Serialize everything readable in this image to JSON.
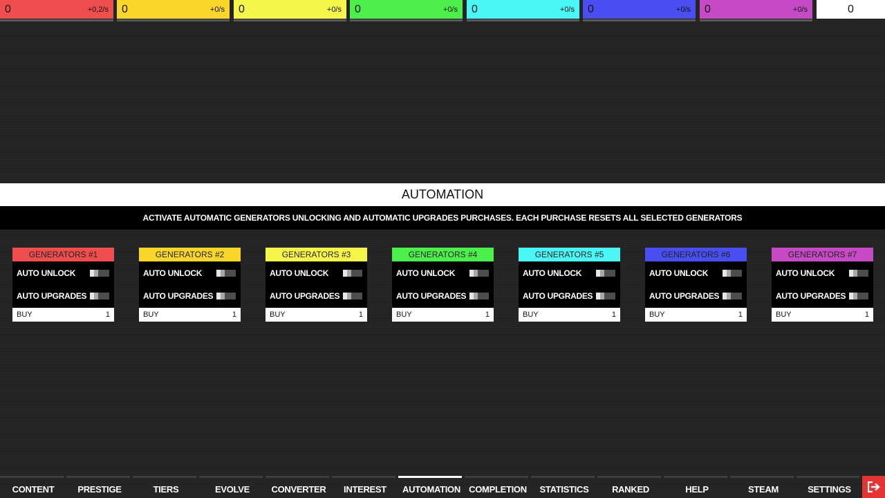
{
  "resources": [
    {
      "amount": "0",
      "rate": "+0,2/s",
      "color": "#f04e4e"
    },
    {
      "amount": "0",
      "rate": "+0/s",
      "color": "#fad52a"
    },
    {
      "amount": "0",
      "rate": "+0/s",
      "color": "#f6f64a"
    },
    {
      "amount": "0",
      "rate": "+0/s",
      "color": "#4df04a"
    },
    {
      "amount": "0",
      "rate": "+0/s",
      "color": "#4af6f6"
    },
    {
      "amount": "0",
      "rate": "+0/s",
      "color": "#4a4ef0"
    },
    {
      "amount": "0",
      "rate": "+0/s",
      "color": "#c64ac6"
    }
  ],
  "total": "0",
  "automation": {
    "title": "AUTOMATION",
    "description": "ACTIVATE AUTOMATIC GENERATORS UNLOCKING AND AUTOMATIC UPGRADES PURCHASES. EACH PURCHASE RESETS ALL SELECTED GENERATORS"
  },
  "generators": [
    {
      "title": "GENERATORS #1",
      "color": "#f04e4e",
      "auto_unlock": "AUTO UNLOCK",
      "auto_upgrades": "AUTO UPGRADES",
      "buy_label": "BUY",
      "buy_value": "1"
    },
    {
      "title": "GENERATORS #2",
      "color": "#fad52a",
      "auto_unlock": "AUTO UNLOCK",
      "auto_upgrades": "AUTO UPGRADES",
      "buy_label": "BUY",
      "buy_value": "1"
    },
    {
      "title": "GENERATORS #3",
      "color": "#f6f64a",
      "auto_unlock": "AUTO UNLOCK",
      "auto_upgrades": "AUTO UPGRADES",
      "buy_label": "BUY",
      "buy_value": "1"
    },
    {
      "title": "GENERATORS #4",
      "color": "#4df04a",
      "auto_unlock": "AUTO UNLOCK",
      "auto_upgrades": "AUTO UPGRADES",
      "buy_label": "BUY",
      "buy_value": "1"
    },
    {
      "title": "GENERATORS #5",
      "color": "#4af6f6",
      "auto_unlock": "AUTO UNLOCK",
      "auto_upgrades": "AUTO UPGRADES",
      "buy_label": "BUY",
      "buy_value": "1"
    },
    {
      "title": "GENERATORS #6",
      "color": "#4a4ef0",
      "auto_unlock": "AUTO UNLOCK",
      "auto_upgrades": "AUTO UPGRADES",
      "buy_label": "BUY",
      "buy_value": "1"
    },
    {
      "title": "GENERATORS #7",
      "color": "#c64ac6",
      "auto_unlock": "AUTO UNLOCK",
      "auto_upgrades": "AUTO UPGRADES",
      "buy_label": "BUY",
      "buy_value": "1"
    }
  ],
  "nav": {
    "items": [
      {
        "label": "CONTENT"
      },
      {
        "label": "PRESTIGE"
      },
      {
        "label": "TIERS"
      },
      {
        "label": "EVOLVE"
      },
      {
        "label": "CONVERTER"
      },
      {
        "label": "INTEREST"
      },
      {
        "label": "AUTOMATION",
        "active": true
      },
      {
        "label": "COMPLETION"
      },
      {
        "label": "STATISTICS"
      },
      {
        "label": "RANKED"
      },
      {
        "label": "HELP"
      },
      {
        "label": "STEAM"
      },
      {
        "label": "SETTINGS"
      }
    ],
    "exit_icon": "exit-icon",
    "exit_color": "#e63333"
  }
}
